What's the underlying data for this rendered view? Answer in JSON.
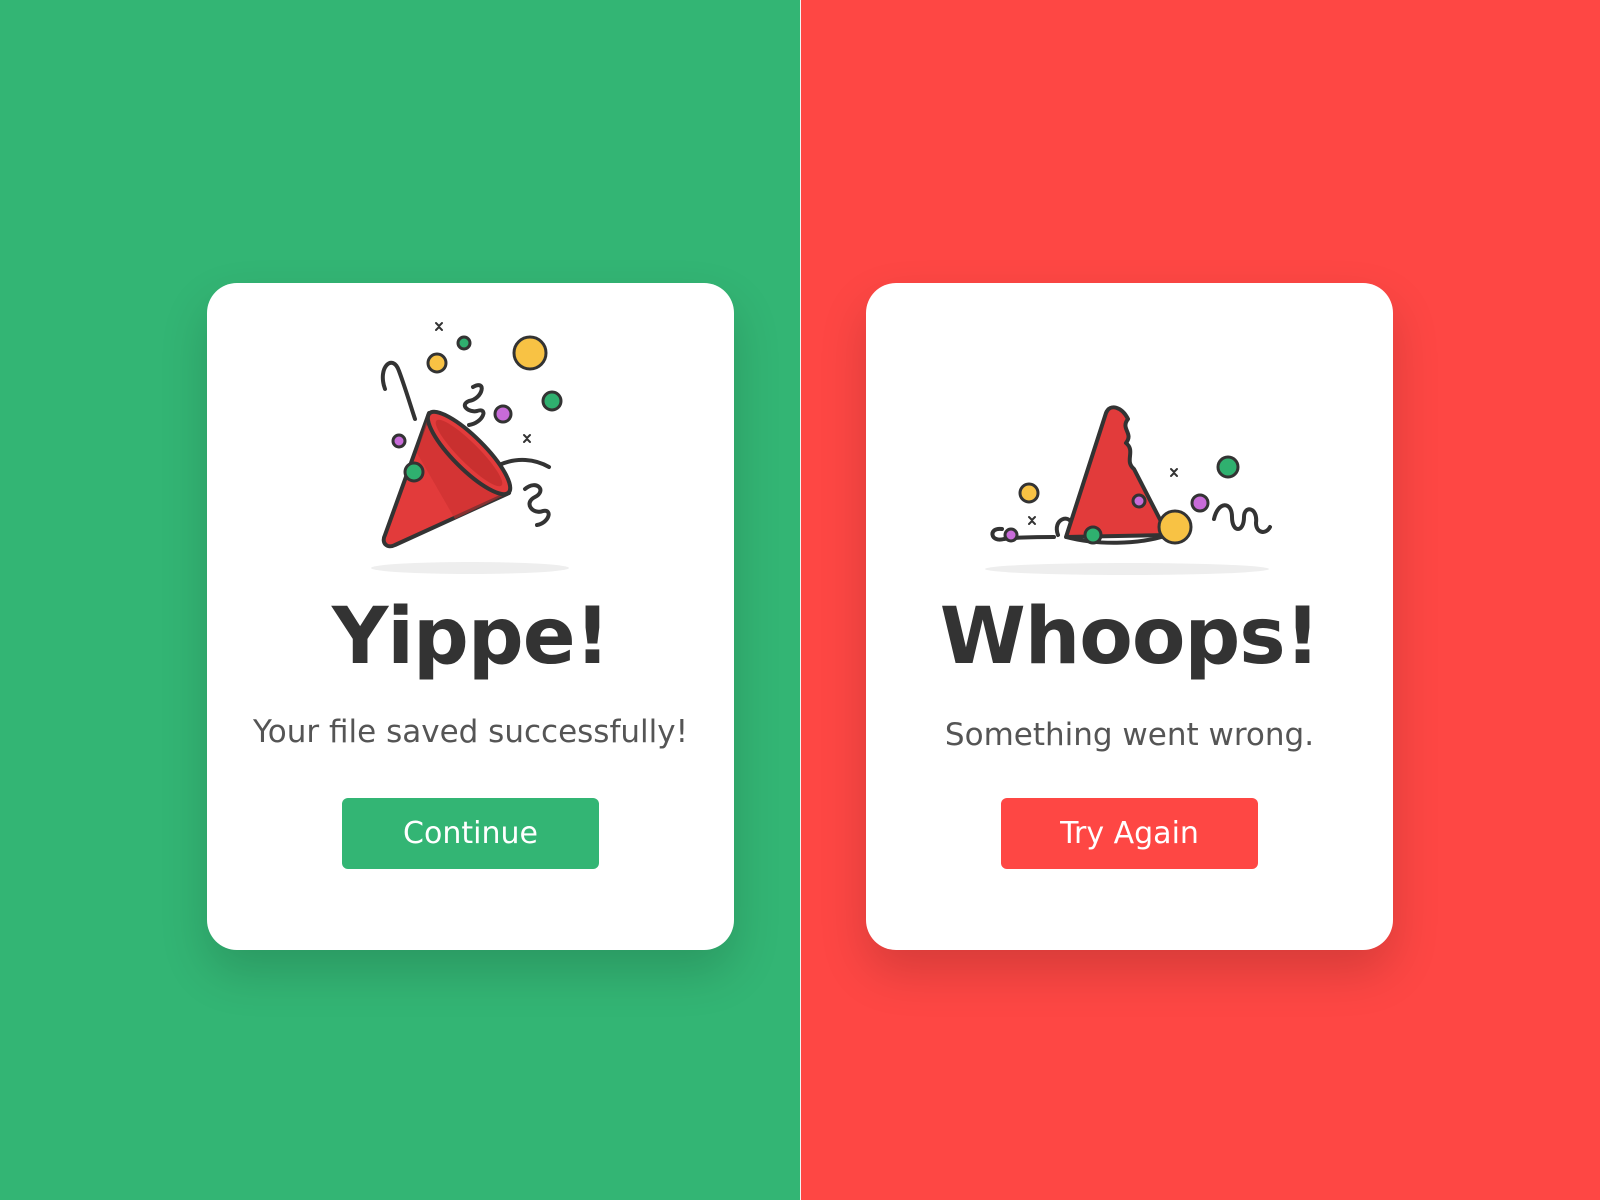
{
  "colors": {
    "success": "#33b574",
    "error": "#fe4744",
    "card": "#ffffff",
    "title": "#333333",
    "message": "#555555",
    "confetti_yellow": "#f8c244",
    "confetti_green": "#2fb06f",
    "confetti_purple": "#c86bd8"
  },
  "success_card": {
    "illustration_icon": "party-popper-icon",
    "title": "Yippe!",
    "message": "Your file saved successfully!",
    "button_label": "Continue"
  },
  "error_card": {
    "illustration_icon": "fallen-party-hat-icon",
    "title": "Whoops!",
    "message": "Something went wrong.",
    "button_label": "Try Again"
  }
}
